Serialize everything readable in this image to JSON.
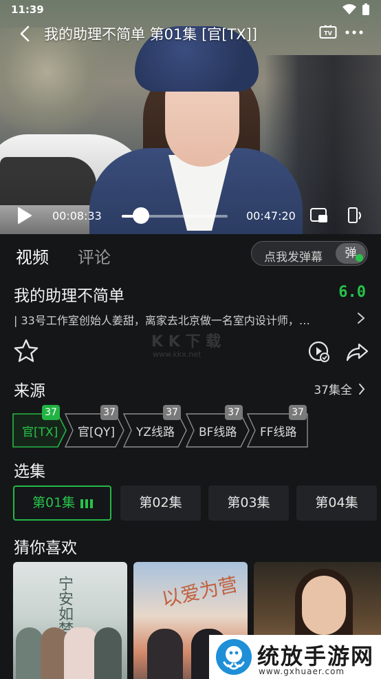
{
  "status_bar": {
    "time": "11:39"
  },
  "player": {
    "title": "我的助理不简单 第01集 [官[TX]]",
    "current_time": "00:08:33",
    "total_time": "00:47:20",
    "progress": 0.181
  },
  "tabs": {
    "video": "视频",
    "comments": "评论"
  },
  "danmu": {
    "placeholder": "点我发弹幕",
    "toggle": "弹"
  },
  "info": {
    "title": "我的助理不简单",
    "rating": "6.0",
    "synopsis": "| 33号工作室创始人姜甜，离家去北京做一名室内设计师，…"
  },
  "watermark": {
    "line1": "K K 下 载",
    "line2": "www.kkx.net"
  },
  "sources": {
    "heading": "来源",
    "all_episodes": "37集全",
    "items": [
      {
        "label": "官[TX]",
        "count": "37",
        "active": true
      },
      {
        "label": "官[QY]",
        "count": "37",
        "active": false
      },
      {
        "label": "YZ线路",
        "count": "37",
        "active": false
      },
      {
        "label": "BF线路",
        "count": "37",
        "active": false
      },
      {
        "label": "FF线路",
        "count": "37",
        "active": false
      }
    ]
  },
  "episodes": {
    "heading": "选集",
    "items": [
      {
        "label": "第01集",
        "active": true
      },
      {
        "label": "第02集",
        "active": false
      },
      {
        "label": "第03集",
        "active": false
      },
      {
        "label": "第04集",
        "active": false
      }
    ]
  },
  "recommend": {
    "heading": "猜你喜欢",
    "items": [
      {
        "title": "宁安如梦"
      },
      {
        "title": "以爱为营"
      },
      {
        "title": ""
      }
    ]
  },
  "brand": {
    "name": "统放手游网",
    "url": "www.gxhuaer.com"
  },
  "colors": {
    "accent": "#27c34a",
    "background": "#151618",
    "card": "#222326"
  }
}
